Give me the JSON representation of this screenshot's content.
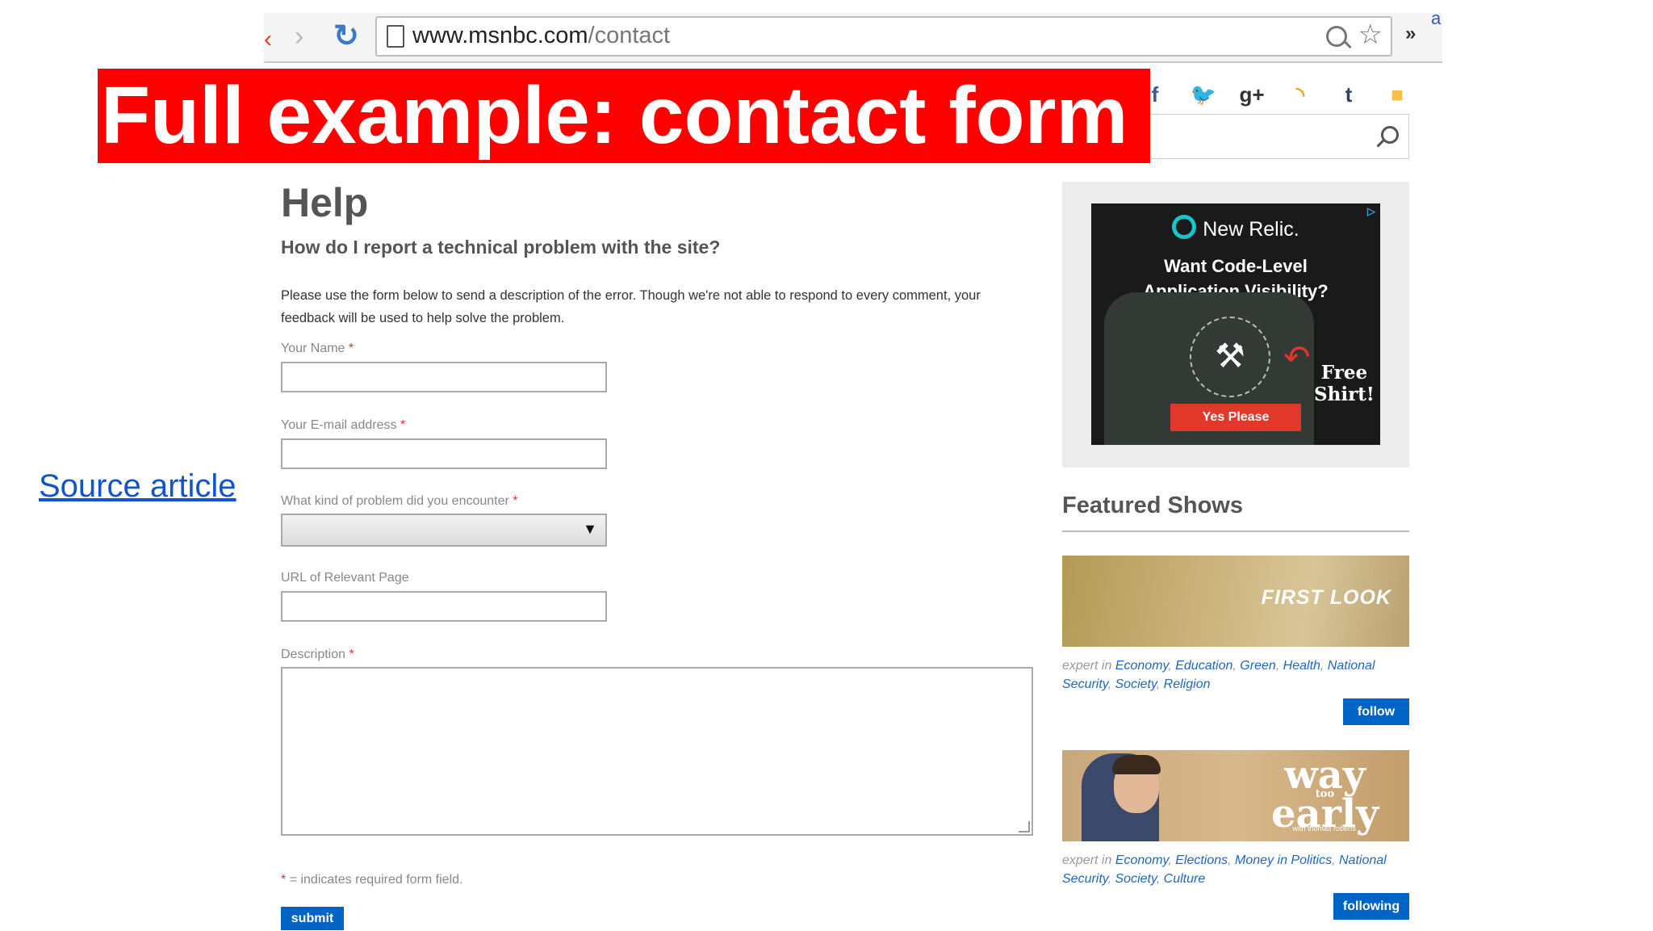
{
  "browser": {
    "url_host": "www.msnbc.com",
    "url_path": "/contact",
    "overflow_label": "»",
    "extension_label": "a"
  },
  "slide": {
    "title": "Full example: contact form",
    "source_link": "Source article"
  },
  "social": [
    {
      "icon": "facebook-icon",
      "glyph": "f",
      "color": "#3b5998"
    },
    {
      "icon": "twitter-icon",
      "glyph": "🐦",
      "color": "#2aa9e0"
    },
    {
      "icon": "google-plus-icon",
      "glyph": "g+",
      "color": "#333333"
    },
    {
      "icon": "rss-icon",
      "glyph": "◝",
      "color": "#f2a516"
    },
    {
      "icon": "tumblr-icon",
      "glyph": "t",
      "color": "#2c4762"
    },
    {
      "icon": "email-icon",
      "glyph": "■",
      "color": "#f5c04a"
    }
  ],
  "page": {
    "title": "Help",
    "subtitle": "How do I report a technical problem with the site?",
    "intro": "Please use the form below to send a description of the error. Though we're not able to respond to every comment, your feedback will be used to help solve the problem."
  },
  "form": {
    "required_marker": "*",
    "name_label": "Your Name",
    "email_label": "Your E-mail address",
    "problem_label": "What kind of problem did you encounter",
    "problem_value": "",
    "url_label": "URL of Relevant Page",
    "description_label": "Description",
    "required_note": "= indicates required form field.",
    "submit_label": "submit"
  },
  "sidebar": {
    "ad": {
      "brand": "New Relic.",
      "tagline_line1": "Want  Code-Level",
      "tagline_line2": "Application Visibility?",
      "free_line1": "Free",
      "free_line2": "Shirt!",
      "cta": "Yes Please",
      "adchoices": "▷"
    },
    "featured_title": "Featured Shows",
    "shows": [
      {
        "name": "FIRST LOOK",
        "expert_prefix": "expert in",
        "topics": [
          "Economy",
          "Education",
          "Green",
          "Health",
          "National Security",
          "Society",
          "Religion"
        ],
        "button": "follow"
      },
      {
        "name_line1": "way",
        "name_small": "too",
        "name_line2": "early",
        "name_sub": "with thomas roberts",
        "expert_prefix": "expert in",
        "topics": [
          "Economy",
          "Elections",
          "Money in Politics",
          "National Security",
          "Society",
          "Culture"
        ],
        "button": "following"
      }
    ]
  }
}
